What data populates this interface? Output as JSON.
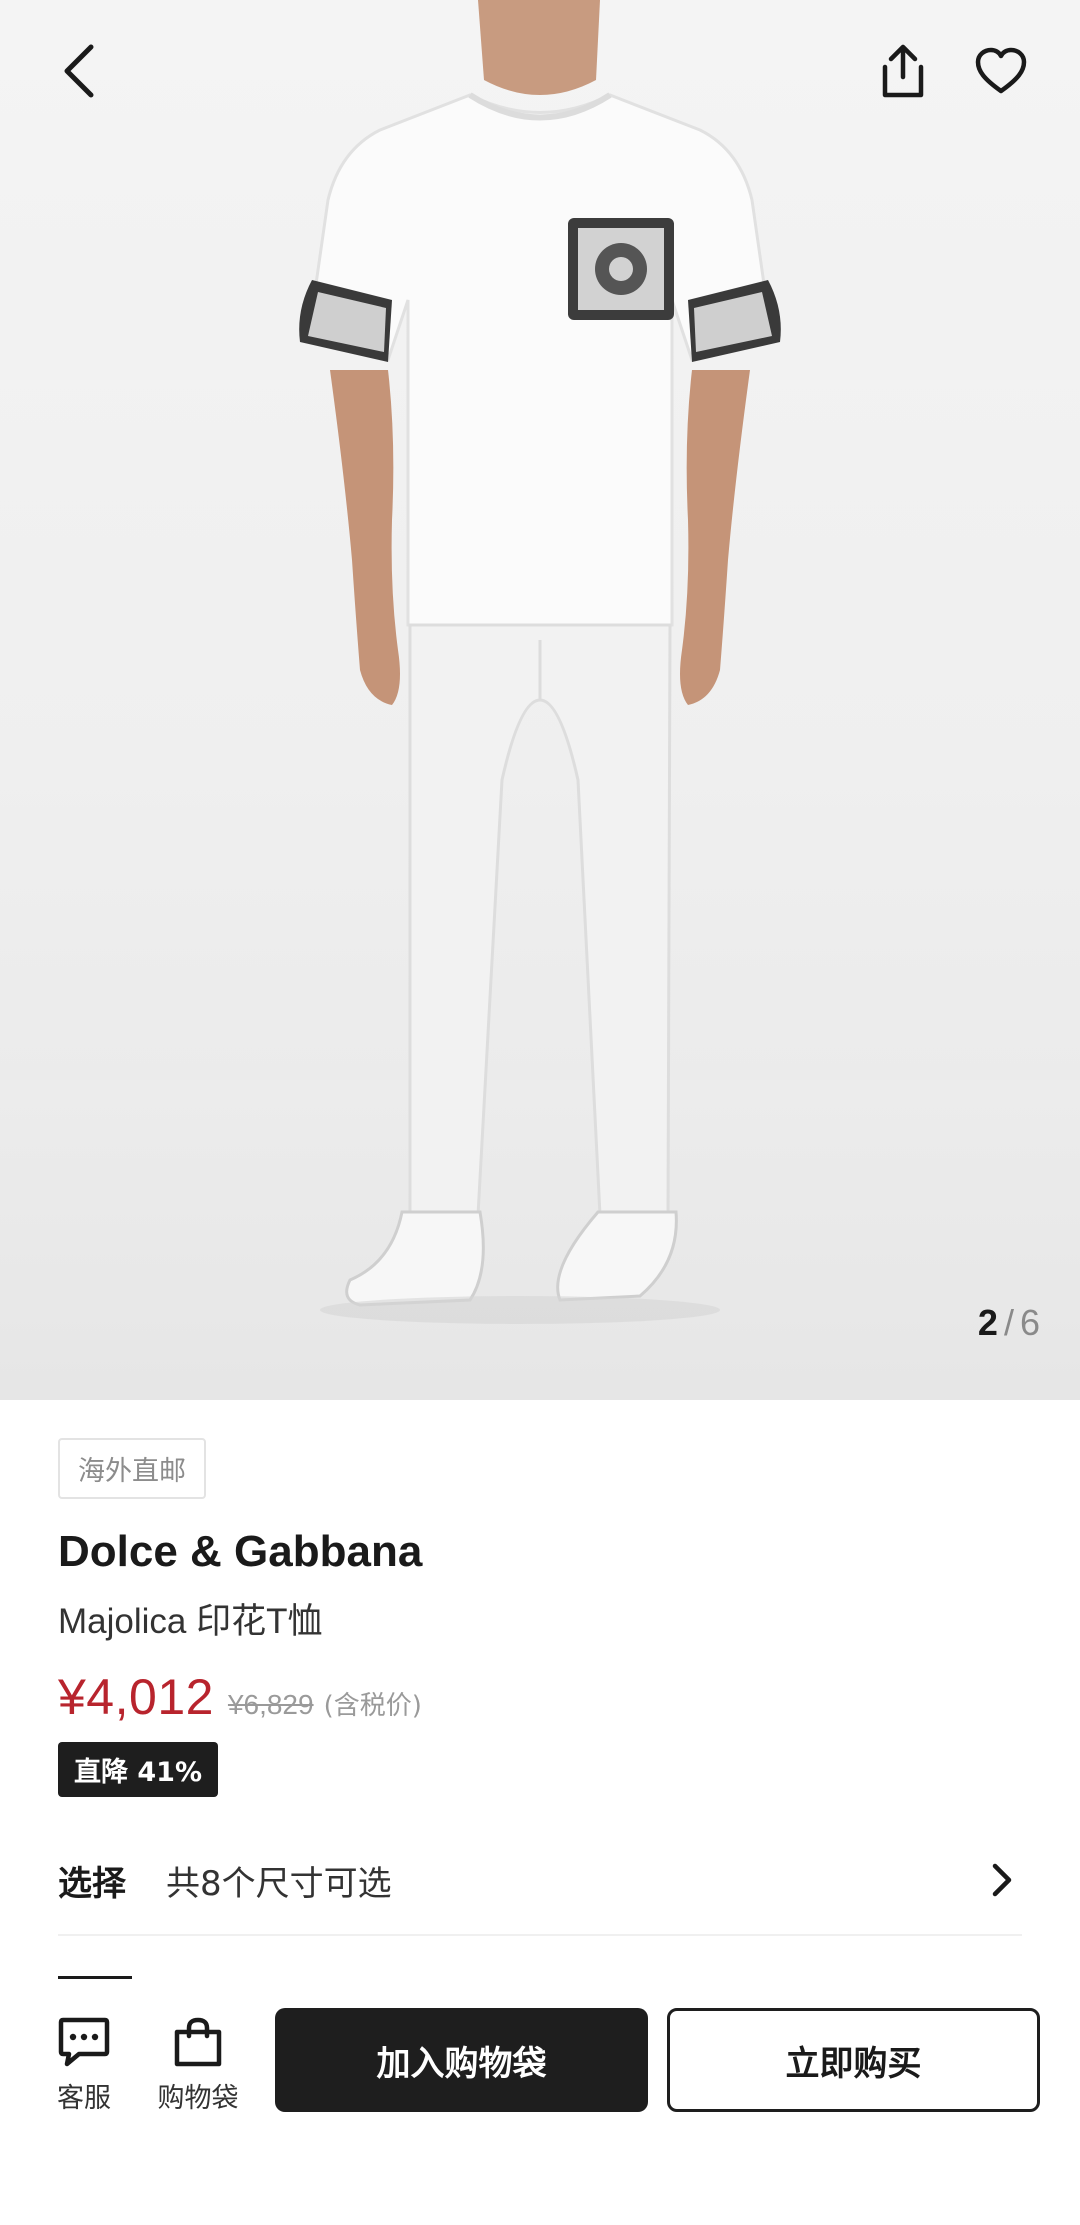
{
  "gallery": {
    "current": "2",
    "separator": "/",
    "total": "6"
  },
  "product": {
    "shipping_tag": "海外直邮",
    "brand": "Dolce & Gabbana",
    "name": "Majolica 印花T恤",
    "price": "¥4,012",
    "original_price": "¥6,829",
    "tax_note": "(含税价)",
    "discount_badge": "直降 41%"
  },
  "size_selector": {
    "label": "选择",
    "value": "共8个尺寸可选"
  },
  "bottom_bar": {
    "customer_service_label": "客服",
    "shopping_bag_label": "购物袋",
    "add_to_cart_label": "加入购物袋",
    "buy_now_label": "立即购买"
  },
  "colors": {
    "price": "#b8242d",
    "primary_button": "#1e1e1e",
    "discount_badge": "#1e1e1e"
  },
  "icons": [
    "back-icon",
    "share-icon",
    "heart-icon",
    "chevron-right-icon",
    "chat-icon",
    "shopping-bag-icon"
  ]
}
